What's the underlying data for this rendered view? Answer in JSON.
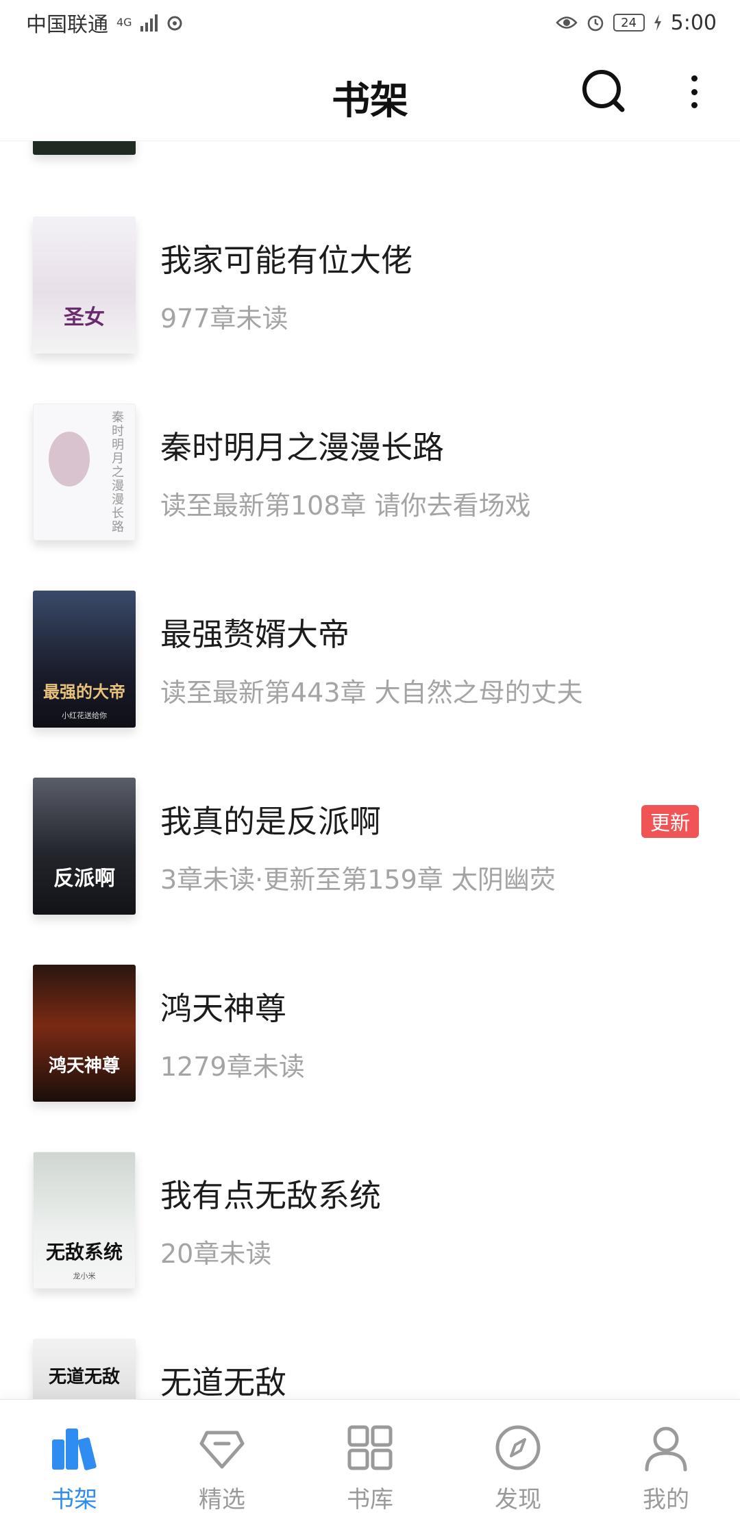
{
  "status_bar": {
    "carrier": "中国联通",
    "network": "4G",
    "battery": "24",
    "time": "5:00"
  },
  "header": {
    "title": "书架",
    "search_icon": "search-icon",
    "more_icon": "more-vertical-icon"
  },
  "books": [
    {
      "title": "我家可能有位大佬",
      "subtitle": "977章未读",
      "badge": "",
      "cover": {
        "text": "圣女",
        "author": "",
        "bg": "#eef0f2",
        "fg": "#6a2a6e"
      }
    },
    {
      "title": "秦时明月之漫漫长路",
      "subtitle": "读至最新第108章 请你去看场戏",
      "badge": "",
      "cover": {
        "text": "秦时明月之漫漫长路",
        "author": "",
        "bg": "#f7f7f9",
        "fg": "#8a8a8a"
      }
    },
    {
      "title": "最强赘婿大帝",
      "subtitle": "读至最新第443章 大自然之母的丈夫",
      "badge": "",
      "cover": {
        "text": "最强的大帝",
        "author": "小红花送给你",
        "bg": "#1e2030",
        "fg": "#e8c27a"
      }
    },
    {
      "title": "我真的是反派啊",
      "subtitle": "3章未读·更新至第159章 太阴幽荧",
      "badge": "更新",
      "cover": {
        "text": "反派啊",
        "author": "",
        "bg": "#2a2c33",
        "fg": "#ffffff"
      }
    },
    {
      "title": "鸿天神尊",
      "subtitle": "1279章未读",
      "badge": "",
      "cover": {
        "text": "鸿天神尊",
        "author": "",
        "bg": "#3a1a12",
        "fg": "#ffffff"
      }
    },
    {
      "title": "我有点无敌系统",
      "subtitle": "20章未读",
      "badge": "",
      "cover": {
        "text": "无敌系统",
        "author": "龙小米",
        "bg": "#e8ecea",
        "fg": "#1a1a1a"
      }
    },
    {
      "title": "无道无敌",
      "subtitle": "",
      "badge": "",
      "cover": {
        "text": "无道无敌",
        "author": "",
        "bg": "#e0e0e0",
        "fg": "#1a1a1a"
      }
    }
  ],
  "bottom_nav": [
    {
      "label": "书架",
      "icon": "bookshelf-icon",
      "active": true
    },
    {
      "label": "精选",
      "icon": "diamond-icon",
      "active": false
    },
    {
      "label": "书库",
      "icon": "grid-icon",
      "active": false
    },
    {
      "label": "发现",
      "icon": "compass-icon",
      "active": false
    },
    {
      "label": "我的",
      "icon": "user-icon",
      "active": false
    }
  ],
  "colors": {
    "accent": "#2f8cf0",
    "badge": "#f05454",
    "subtitle": "#a4a4a4",
    "nav_inactive": "#9a9a9a"
  }
}
